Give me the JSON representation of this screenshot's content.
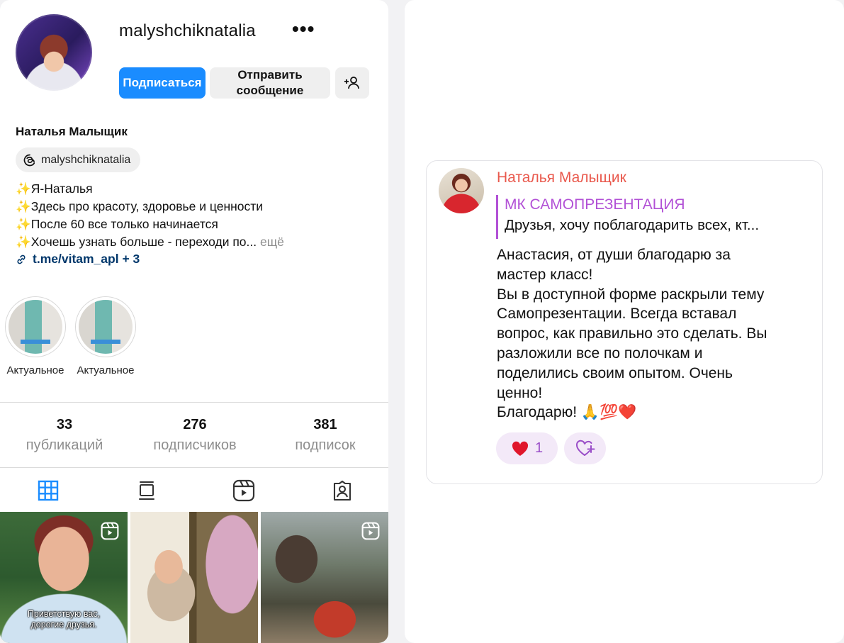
{
  "profile": {
    "username": "malyshchiknatalia",
    "more_glyph": "•••",
    "follow_label": "Подписаться",
    "message_label": "Отправить\nсообщение",
    "display_name": "Наталья Малыщик",
    "threads_handle": "malyshchiknatalia",
    "bio": [
      "✨Я-Наталья",
      "✨Здесь про красоту, здоровье и ценности",
      "✨После 60 все только начинается",
      "✨Хочешь узнать больше - переходи по..."
    ],
    "bio_more": "ещё",
    "link": "t.me/vitam_apl + 3",
    "highlights": [
      {
        "label": "Актуальное"
      },
      {
        "label": "Актуальное"
      }
    ],
    "stats": [
      {
        "value": "33",
        "label": "публикаций"
      },
      {
        "value": "276",
        "label": "подписчиков"
      },
      {
        "value": "381",
        "label": "подписок"
      }
    ],
    "tabs": [
      "grid",
      "feed",
      "reels",
      "tagged"
    ],
    "posts": [
      {
        "caption": "Приветствую вас, дорогие друзья.",
        "is_reel": true
      },
      {
        "caption": "",
        "is_reel": false
      },
      {
        "caption": "",
        "is_reel": true
      }
    ],
    "accent_color": "#1a8cff"
  },
  "message": {
    "author": "Наталья Малыщик",
    "author_color": "#e9584c",
    "quote_title": "МК САМОПРЕЗЕНТАЦИЯ",
    "quote_text": "Друзья, хочу поблагодарить всех, кт...",
    "quote_color": "#b251d6",
    "body_lines": [
      "Анастасия, от души благодарю за",
      "мастер класс!",
      "Вы в доступной форме раскрыли тему",
      "Самопрезентации. Всегда вставал",
      "вопрос, как правильно это сделать. Вы",
      "разложили все по полочкам и",
      "поделились своим опытом. Очень",
      "ценно!",
      "Благодарю! 🙏💯❤️"
    ],
    "reaction_count": "1"
  }
}
